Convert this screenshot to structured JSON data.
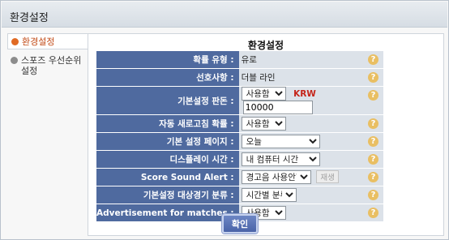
{
  "window": {
    "title": "환경설정"
  },
  "sidebar": {
    "items": [
      {
        "label": "환경설정",
        "active": true
      },
      {
        "label": "스포즈 우선순위 설정",
        "active": false
      }
    ]
  },
  "panel": {
    "title": "환경설정"
  },
  "rows": {
    "odds_type": {
      "label": "확률 유형 :",
      "value": "유로"
    },
    "preference": {
      "label": "선호사항 :",
      "value": "더블 라인"
    },
    "default_bet": {
      "label": "기본설정 판돈 :",
      "select": "사용함",
      "currency": "KRW",
      "amount": "10000"
    },
    "auto_refresh": {
      "label": "자동 새로고침 확률 :",
      "select": "사용함"
    },
    "default_page": {
      "label": "기본 설정 페이지 :",
      "select": "오늘"
    },
    "display_time": {
      "label": "디스플레이 시간 :",
      "select": "내 컴퓨터 시간"
    },
    "score_alert": {
      "label": "Score Sound Alert :",
      "select": "경고음 사용안함",
      "button": "재생"
    },
    "default_sort": {
      "label": "기본설정 대상경기 분류 :",
      "select": "시간별 분류"
    },
    "advertisement": {
      "label": "Advertisement for matches :",
      "select": "사용함"
    }
  },
  "help_icon": "?",
  "confirm_button": "확인",
  "colors": {
    "label_bg": "#4f6a9f",
    "value_bg": "#dce2e9",
    "active_tab": "#c24a16",
    "krw": "#c5261b",
    "help": "#e9bf63"
  }
}
